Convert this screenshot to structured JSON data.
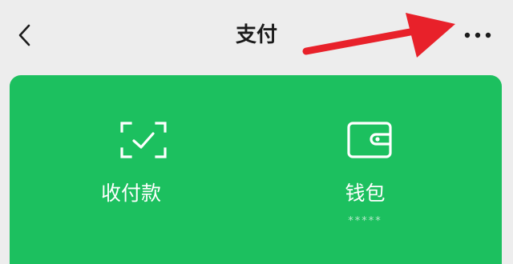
{
  "header": {
    "title": "支付",
    "back_icon": "chevron-left-icon",
    "more_icon": "more-horizontal-icon"
  },
  "pay_card": {
    "background": "#1cc05f",
    "items": [
      {
        "label": "收付款",
        "icon": "scan-check-icon"
      },
      {
        "label": "钱包",
        "icon": "wallet-icon",
        "balance_masked": "*****"
      }
    ]
  },
  "annotation": {
    "arrow_color": "#e8212a",
    "points_to": "more-button"
  }
}
